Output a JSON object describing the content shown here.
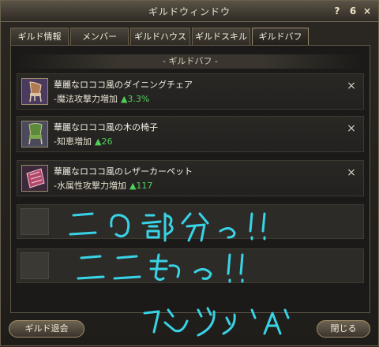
{
  "window": {
    "title": "ギルドウィンドウ",
    "help_label": "?",
    "minimize_label": "6",
    "close_label": "×"
  },
  "tabs": [
    {
      "label": "ギルド情報"
    },
    {
      "label": "メンバー"
    },
    {
      "label": "ギルドハウス"
    },
    {
      "label": "ギルドスキル"
    },
    {
      "label": "ギルドバフ",
      "active": true
    }
  ],
  "buff_panel": {
    "header": "- ギルドバフ -",
    "items": [
      {
        "name": "華麗なロココ風のダイニングチェア",
        "effect": "-魔法攻撃力増加",
        "value": "▲3.3%",
        "icon": "dining-chair-icon"
      },
      {
        "name": "華麗なロココ風の木の椅子",
        "effect": "-知恵増加",
        "value": "▲26",
        "icon": "wooden-chair-icon"
      },
      {
        "name": "華麗なロココ風のレザーカーペット",
        "effect": "-水属性攻撃力増加",
        "value": "▲117",
        "icon": "leather-carpet-icon"
      }
    ],
    "remove_label": "×"
  },
  "footer": {
    "leave_label": "ギルド退会",
    "close_label": "閉じる"
  },
  "colors": {
    "value_green": "#4fd05a",
    "scribble_cyan": "#38d3e6"
  }
}
